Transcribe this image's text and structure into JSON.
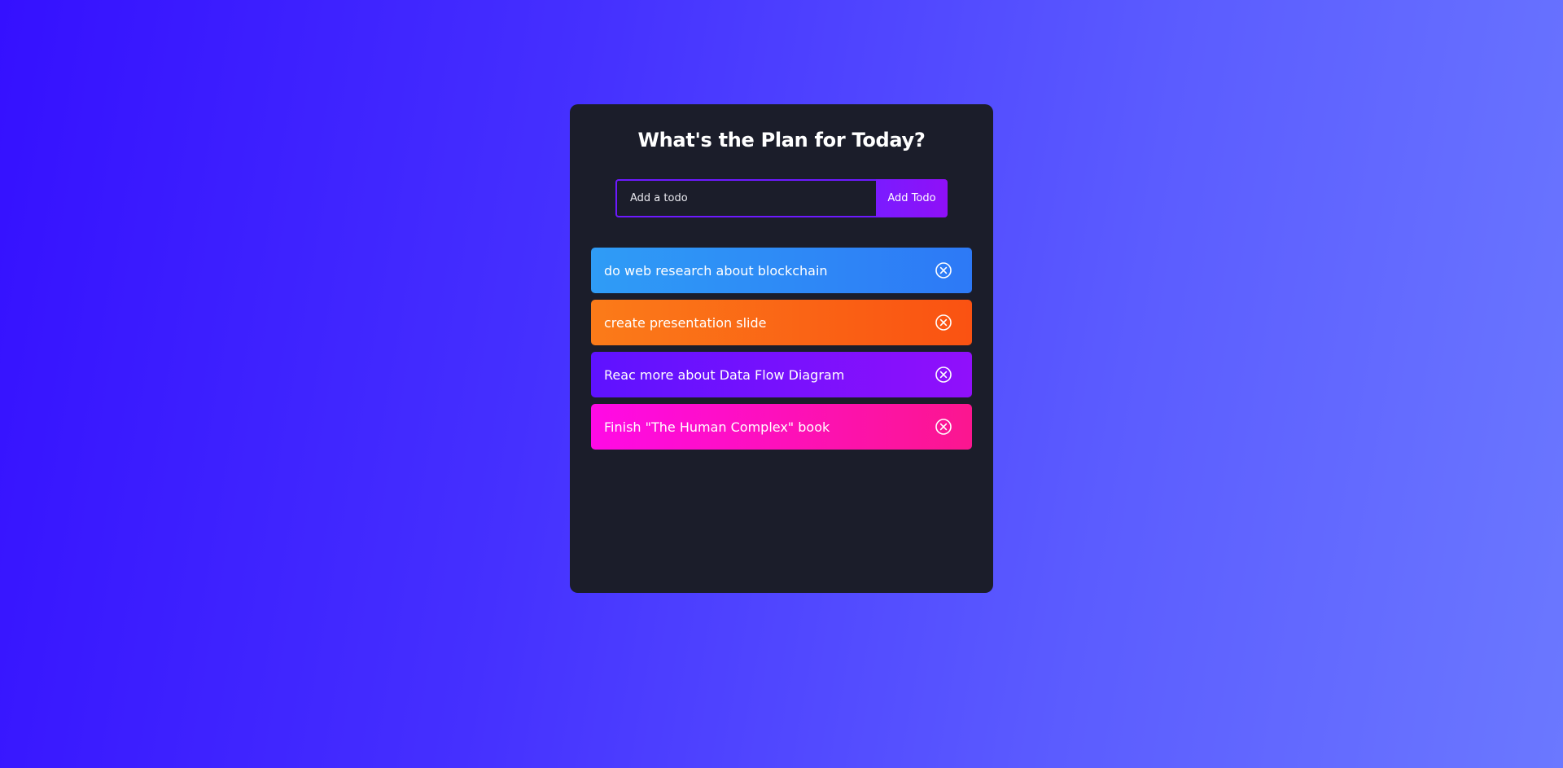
{
  "app": {
    "title": "What's the Plan for Today?"
  },
  "form": {
    "input_placeholder": "Add a todo",
    "input_value": "",
    "button_label": "Add Todo"
  },
  "todos": [
    {
      "text": "do web research about blockchain",
      "color": "blue",
      "delete_icon": "close-circle-icon"
    },
    {
      "text": "create presentation slide",
      "color": "orange",
      "delete_icon": "close-circle-icon"
    },
    {
      "text": "Reac more about Data Flow Diagram",
      "color": "purple",
      "delete_icon": "close-circle-icon"
    },
    {
      "text": "Finish \"The Human Complex\" book",
      "color": "pink",
      "delete_icon": "close-circle-icon"
    }
  ],
  "colors": {
    "panel_background": "#1b1d2a",
    "accent": "#6d19ff",
    "blue": "#2f9cf6",
    "orange": "#fb7b19",
    "purple": "#5e12ff",
    "pink": "#ff0ae6"
  }
}
